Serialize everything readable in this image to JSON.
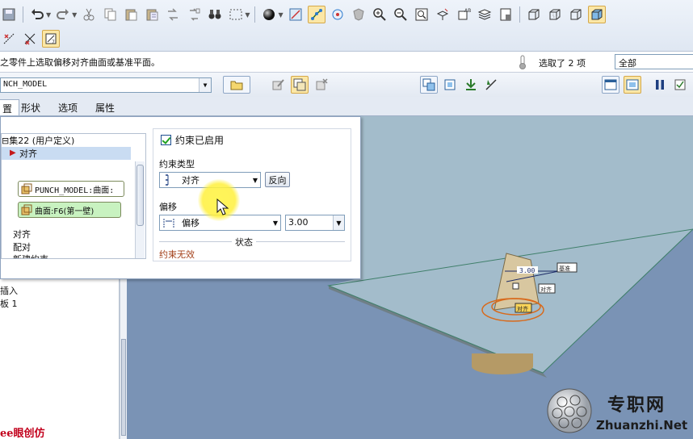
{
  "message_bar": {
    "prompt": "之零件上选取偏移对齐曲面或基准平面。",
    "selected_text": "选取了 2 项",
    "filter_value": "全部"
  },
  "dashboard": {
    "reference_value": "NCH_MODEL"
  },
  "tabs": [
    {
      "label": "置"
    },
    {
      "label": "形状"
    },
    {
      "label": "选项"
    },
    {
      "label": "属性"
    }
  ],
  "placement": {
    "set_header": "集22 (用户定义)",
    "constraint_label": "对齐",
    "reference_1": "PUNCH_MODEL:曲面:",
    "reference_2": "曲面:F6(第一壁)",
    "list_options": [
      "对齐",
      "配对",
      "新建约束"
    ],
    "enabled_label": "约束已启用",
    "enabled": true,
    "constraint_type_label": "约束类型",
    "constraint_type_value": "对齐",
    "flip_label": "反向",
    "offset_label": "偏移",
    "offset_type_value": "偏移",
    "offset_value": "3.00",
    "status_title": "状态",
    "status_value": "约束无效"
  },
  "tree": {
    "items": [
      "插入",
      "板 1"
    ],
    "footer_logo": "ee眼创仿"
  },
  "viewport": {
    "dim_label": "3.00",
    "tag_1": "基准",
    "tag_2": "对齐",
    "tag_3": "对齐"
  },
  "watermark": {
    "title": "专职网",
    "url": "Zhuanzhi.Net"
  },
  "colors": {
    "viewport_bg": "#7a93b5",
    "plate": "#a3bccb",
    "chip_green": "#c8f2c0",
    "status_red": "#a3401a",
    "active_yellow": "#fbe7a6"
  }
}
